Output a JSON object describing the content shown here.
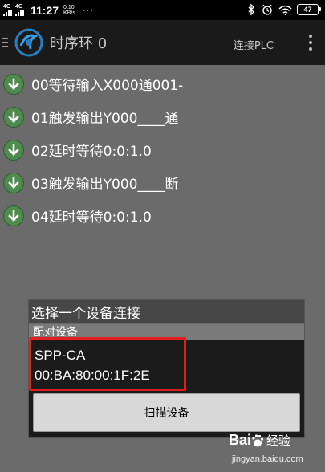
{
  "status_bar": {
    "signal1": "4G",
    "signal2": "4G",
    "time": "11:27",
    "speed_value": "0.10",
    "speed_unit": "KB/s",
    "more": "···",
    "battery": "47",
    "icons": [
      "bluetooth-icon",
      "alarm-icon",
      "wifi-icon",
      "battery-icon"
    ]
  },
  "app_bar": {
    "title": "时序环 0",
    "connect_label": "连接PLC",
    "icons": [
      "menu-icon",
      "app-logo",
      "overflow-menu-icon"
    ]
  },
  "steps": [
    {
      "label": "00等待输入X000通001-"
    },
    {
      "label": "01触发输出Y000____通"
    },
    {
      "label": "02延时等待0:0:1.0"
    },
    {
      "label": "03触发输出Y000____断"
    },
    {
      "label": "04延时等待0:0:1.0"
    }
  ],
  "dialog": {
    "title": "选择一个设备连接",
    "section": "配对设备",
    "device_name": "SPP-CA",
    "device_mac": "00:BA:80:00:1F:2E",
    "scan_button": "扫描设备",
    "highlight_color": "#e02020"
  },
  "watermark": {
    "brand": "Bai",
    "brand2": "经验",
    "url": "jingyan.baidu.com"
  },
  "colors": {
    "accent_green": "#4f8a4f",
    "background": "#6b6b6b"
  }
}
